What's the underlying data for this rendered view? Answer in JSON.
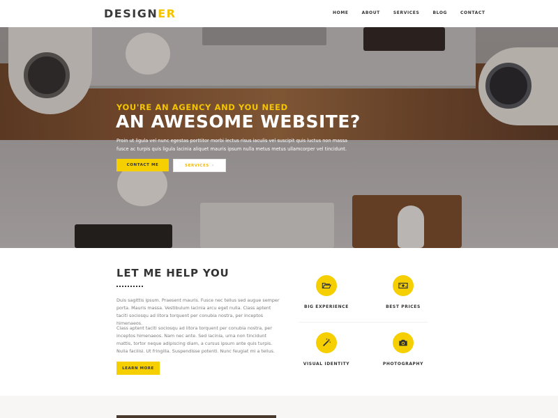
{
  "header": {
    "logo_main": "DESIGN",
    "logo_accent": "ER",
    "nav": [
      "HOME",
      "ABOUT",
      "SERVICES",
      "BLOG",
      "CONTACT"
    ]
  },
  "hero": {
    "subtitle": "YOU'RE AN AGENCY AND YOU NEED",
    "title": "AN AWESOME WEBSITE?",
    "text": "Proin ut ligula vel nunc egestas porttitor morbi lectus risus iaculis vel suscipit quis luctus non massa fusce ac turpis quis ligula lacinia aliquet mauris ipsum nulla metus metus ullamcorper vel tincidunt.",
    "contact_button": "CONTACT ME",
    "services_button": "SERVICES",
    "services_chevron": "›"
  },
  "help": {
    "title": "LET ME HELP YOU",
    "paragraph1": "Duis sagittis ipsum. Praesent mauris. Fusce nec tellus sed augue semper porta. Mauris massa. Vestibulum lacinia arcu eget nulla. Class aptent taciti sociosqu ad litora torquent per conubia nostra, per inceptos himenaeos.",
    "paragraph2": "Class aptent taciti sociosqu ad litora torquent per conubia nostra, per inceptos himenaeos. Nam nec ante. Sed lacinia, urna non tincidunt mattis, tortor neque adipiscing diam, a cursus ipsum ante quis turpis. Nulla facilisi. Ut fringilla. Suspendisse potenti. Nunc feugiat mi a tellus.",
    "more_button": "LEARN MORE"
  },
  "features": [
    {
      "label": "BIG EXPERIENCE",
      "icon": "folder-open-icon"
    },
    {
      "label": "BEST PRICES",
      "icon": "money-icon"
    },
    {
      "label": "VISUAL IDENTITY",
      "icon": "magic-wand-icon"
    },
    {
      "label": "PHOTOGRAPHY",
      "icon": "camera-icon"
    }
  ],
  "colors": {
    "accent": "#f5cf00",
    "heading": "#333333",
    "body_text": "#7a7a7a"
  }
}
